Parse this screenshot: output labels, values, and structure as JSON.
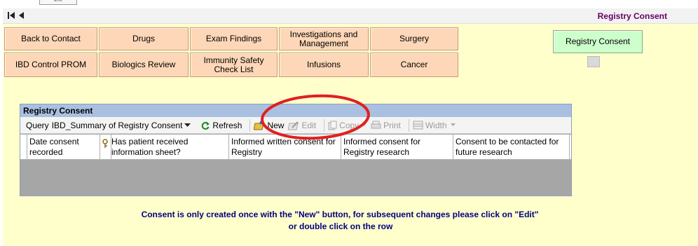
{
  "top_tab": {
    "label": "ame"
  },
  "nav": {
    "first_symbol": "K",
    "prev_symbol": "◀",
    "title": "Registry Consent"
  },
  "tabs_row1": [
    {
      "label": "Back to Contact"
    },
    {
      "label": "Drugs"
    },
    {
      "label": "Exam Findings"
    },
    {
      "label": "Investigations and Management"
    },
    {
      "label": "Surgery"
    }
  ],
  "tabs_row2": [
    {
      "label": "IBD Control PROM"
    },
    {
      "label": "Biologics Review"
    },
    {
      "label": "Immunity Safety Check List"
    },
    {
      "label": "Infusions"
    },
    {
      "label": "Cancer"
    }
  ],
  "active_tab": {
    "label": "Registry Consent"
  },
  "panel": {
    "title": "Registry Consent",
    "toolbar": {
      "query_label": "Query",
      "query_value": "IBD_Summary of Registry Consent",
      "refresh": "Refresh",
      "new": "New",
      "edit": "Edit",
      "copy": "Copy",
      "print": "Print",
      "width": "Width"
    },
    "columns": [
      "Date consent recorded",
      "Has patient received information sheet?",
      "Informed written consent for Registry",
      "Informed consent for Registry research",
      "Consent to be contacted for future research"
    ]
  },
  "info": {
    "line1": "Consent is only created once with the \"New\" button, for subsequent changes please click on \"Edit\"",
    "line2": "or double click on the row"
  },
  "colors": {
    "background": "#ffffcc",
    "tab": "#fdd7b8",
    "active_tab": "#ccffcc",
    "panel_header": "#a9c0e0",
    "grid_body": "#a6a6a6",
    "highlight_ellipse": "#e02020",
    "info_text": "#000080",
    "title": "#660066"
  }
}
